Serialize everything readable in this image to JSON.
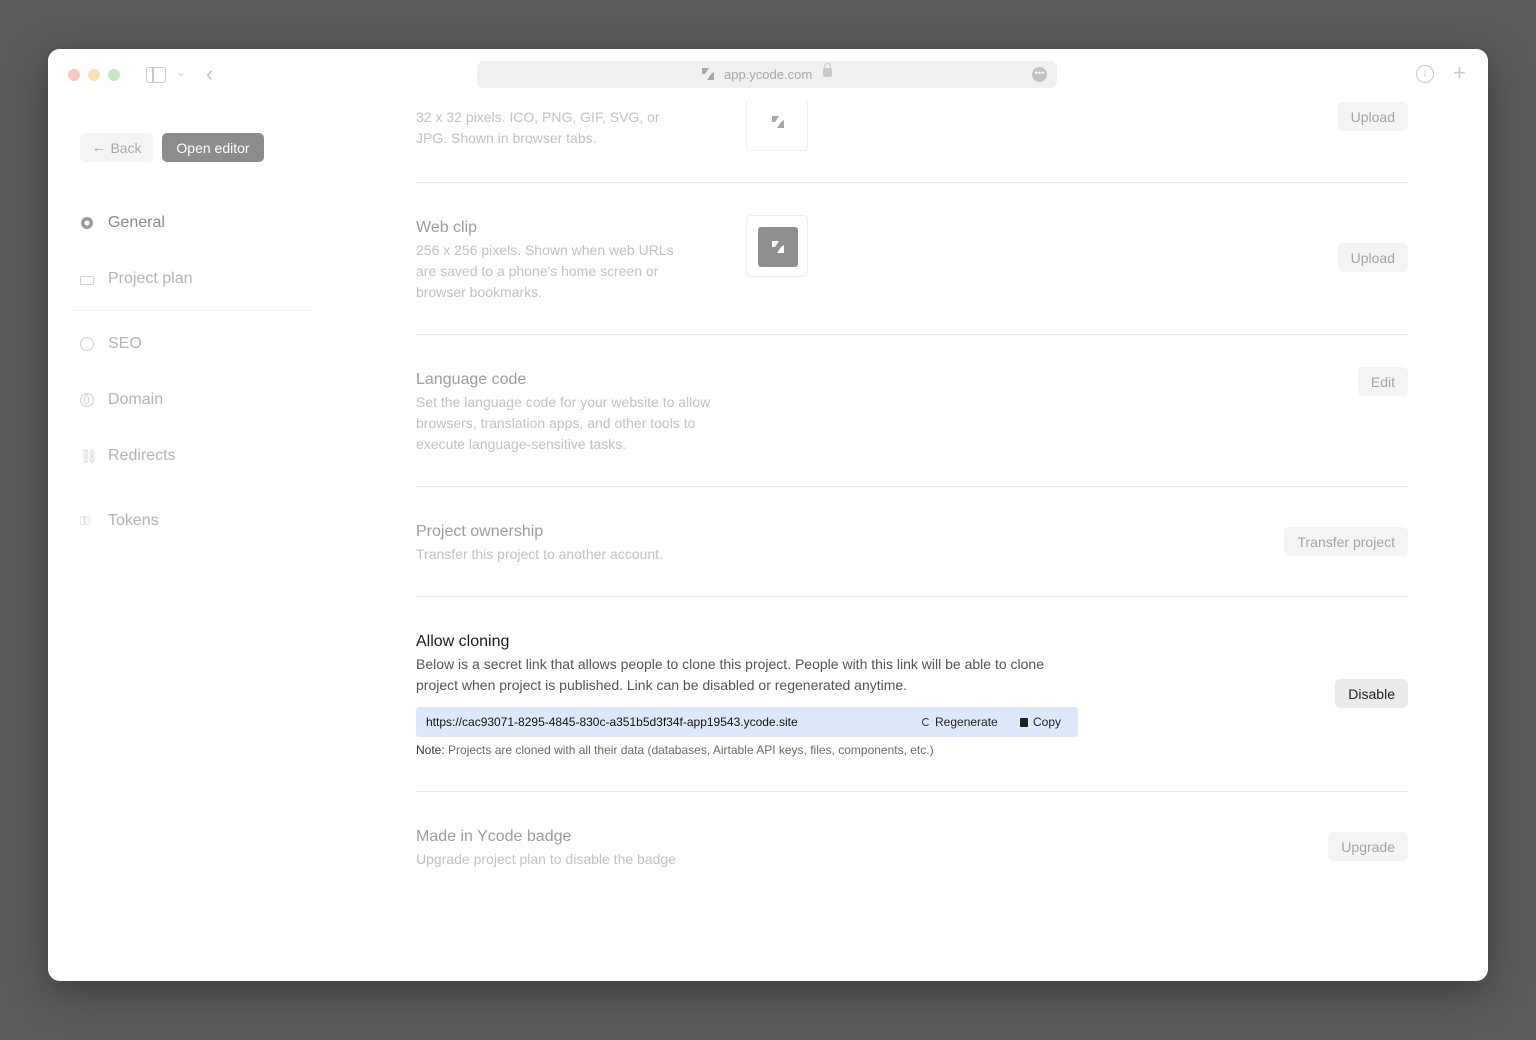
{
  "browser": {
    "url": "app.ycode.com"
  },
  "nav": {
    "back_label": "Back",
    "open_editor_label": "Open editor",
    "items": [
      {
        "label": "General",
        "icon": "gear-icon"
      },
      {
        "label": "Project plan",
        "icon": "credit-card-icon"
      },
      {
        "label": "SEO",
        "icon": "seo-icon"
      },
      {
        "label": "Domain",
        "icon": "globe-icon"
      },
      {
        "label": "Redirects",
        "icon": "link-icon"
      },
      {
        "label": "Tokens",
        "icon": "key-icon"
      }
    ]
  },
  "settings": {
    "favicon": {
      "desc_line1": "32 x 32 pixels. ICO, PNG, GIF, SVG, or",
      "desc_line2": "JPG. Shown in browser tabs.",
      "button": "Upload"
    },
    "webclip": {
      "title": "Web clip",
      "desc_line1": "256 x 256 pixels. Shown when web URLs",
      "desc_line2": "are saved to a phone's home screen or",
      "desc_line3": "browser bookmarks.",
      "button": "Upload"
    },
    "language": {
      "title": "Language code",
      "desc_line1": "Set the language code for your website to allow",
      "desc_line2": "browsers, translation apps, and other tools to",
      "desc_line3": "execute language-sensitive tasks.",
      "button": "Edit"
    },
    "ownership": {
      "title": "Project ownership",
      "desc": "Transfer this project to another account.",
      "button": "Transfer project"
    },
    "cloning": {
      "title": "Allow cloning",
      "desc_line1": "Below is a secret link that allows people to clone this project. People with this link will be able to clone",
      "desc_line2": "project when project is published. Link can be disabled or regenerated anytime.",
      "link": "https://cac93071-8295-4845-830c-a351b5d3f34f-app19543.ycode.site",
      "regenerate": "Regenerate",
      "copy": "Copy",
      "note_label": "Note:",
      "note_text": " Projects are cloned with all their data (databases, Airtable API keys, files, components, etc.)",
      "button": "Disable"
    },
    "badge": {
      "title": "Made in Ycode badge",
      "desc": "Upgrade project plan to disable the badge",
      "button": "Upgrade"
    }
  },
  "colors": {
    "page_bg": "#5b5b5b",
    "clone_link_bg": "#dde9fb",
    "open_editor_bg": "#8c8c8c"
  }
}
